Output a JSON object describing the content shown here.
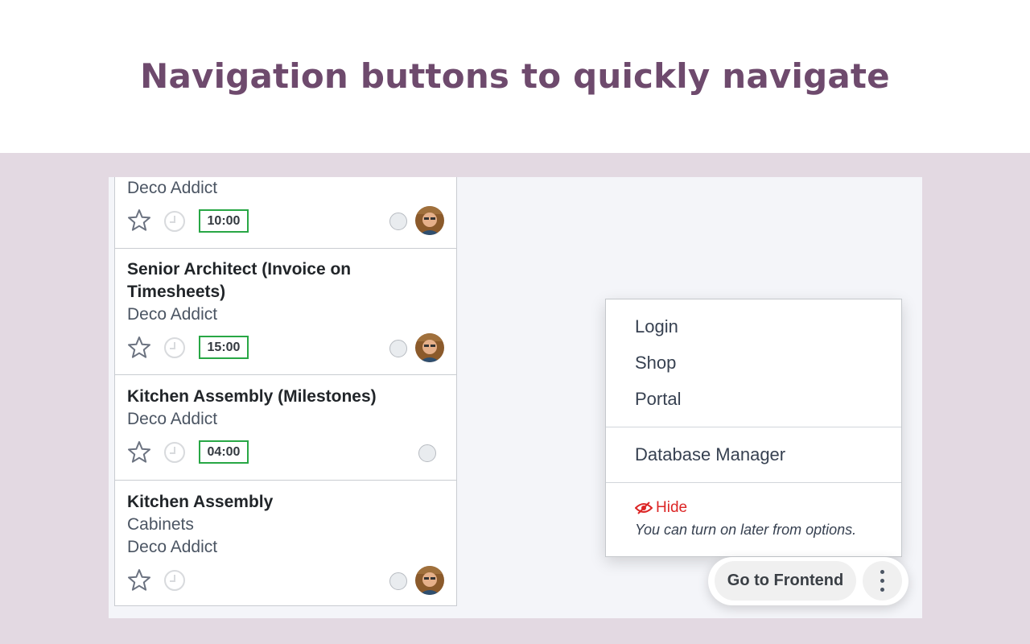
{
  "headline": "Navigation buttons to quickly navigate",
  "cards": [
    {
      "title": "",
      "lines": [
        "Deco Addict"
      ],
      "time": "10:00"
    },
    {
      "title": "Senior Architect (Invoice on Timesheets)",
      "lines": [
        "Deco Addict"
      ],
      "time": "15:00"
    },
    {
      "title": "Kitchen Assembly (Milestones)",
      "lines": [
        "Deco Addict"
      ],
      "time": "04:00"
    },
    {
      "title": "Kitchen Assembly",
      "lines": [
        "Cabinets",
        "Deco Addict"
      ],
      "time": ""
    }
  ],
  "menu": {
    "items": [
      "Login",
      "Shop",
      "Portal"
    ],
    "database_manager": "Database Manager",
    "hide_label": "Hide",
    "hint": "You can turn on later from options."
  },
  "frontend_button": "Go to Frontend",
  "colors": {
    "headline": "#6e4a6d",
    "band": "#e3d9e2",
    "time_border": "#28a745",
    "hide_red": "#dc2626"
  },
  "icons": [
    "star-icon",
    "clock-icon",
    "status-circle-icon",
    "avatar",
    "eye-slash-icon",
    "more-vertical-icon"
  ]
}
